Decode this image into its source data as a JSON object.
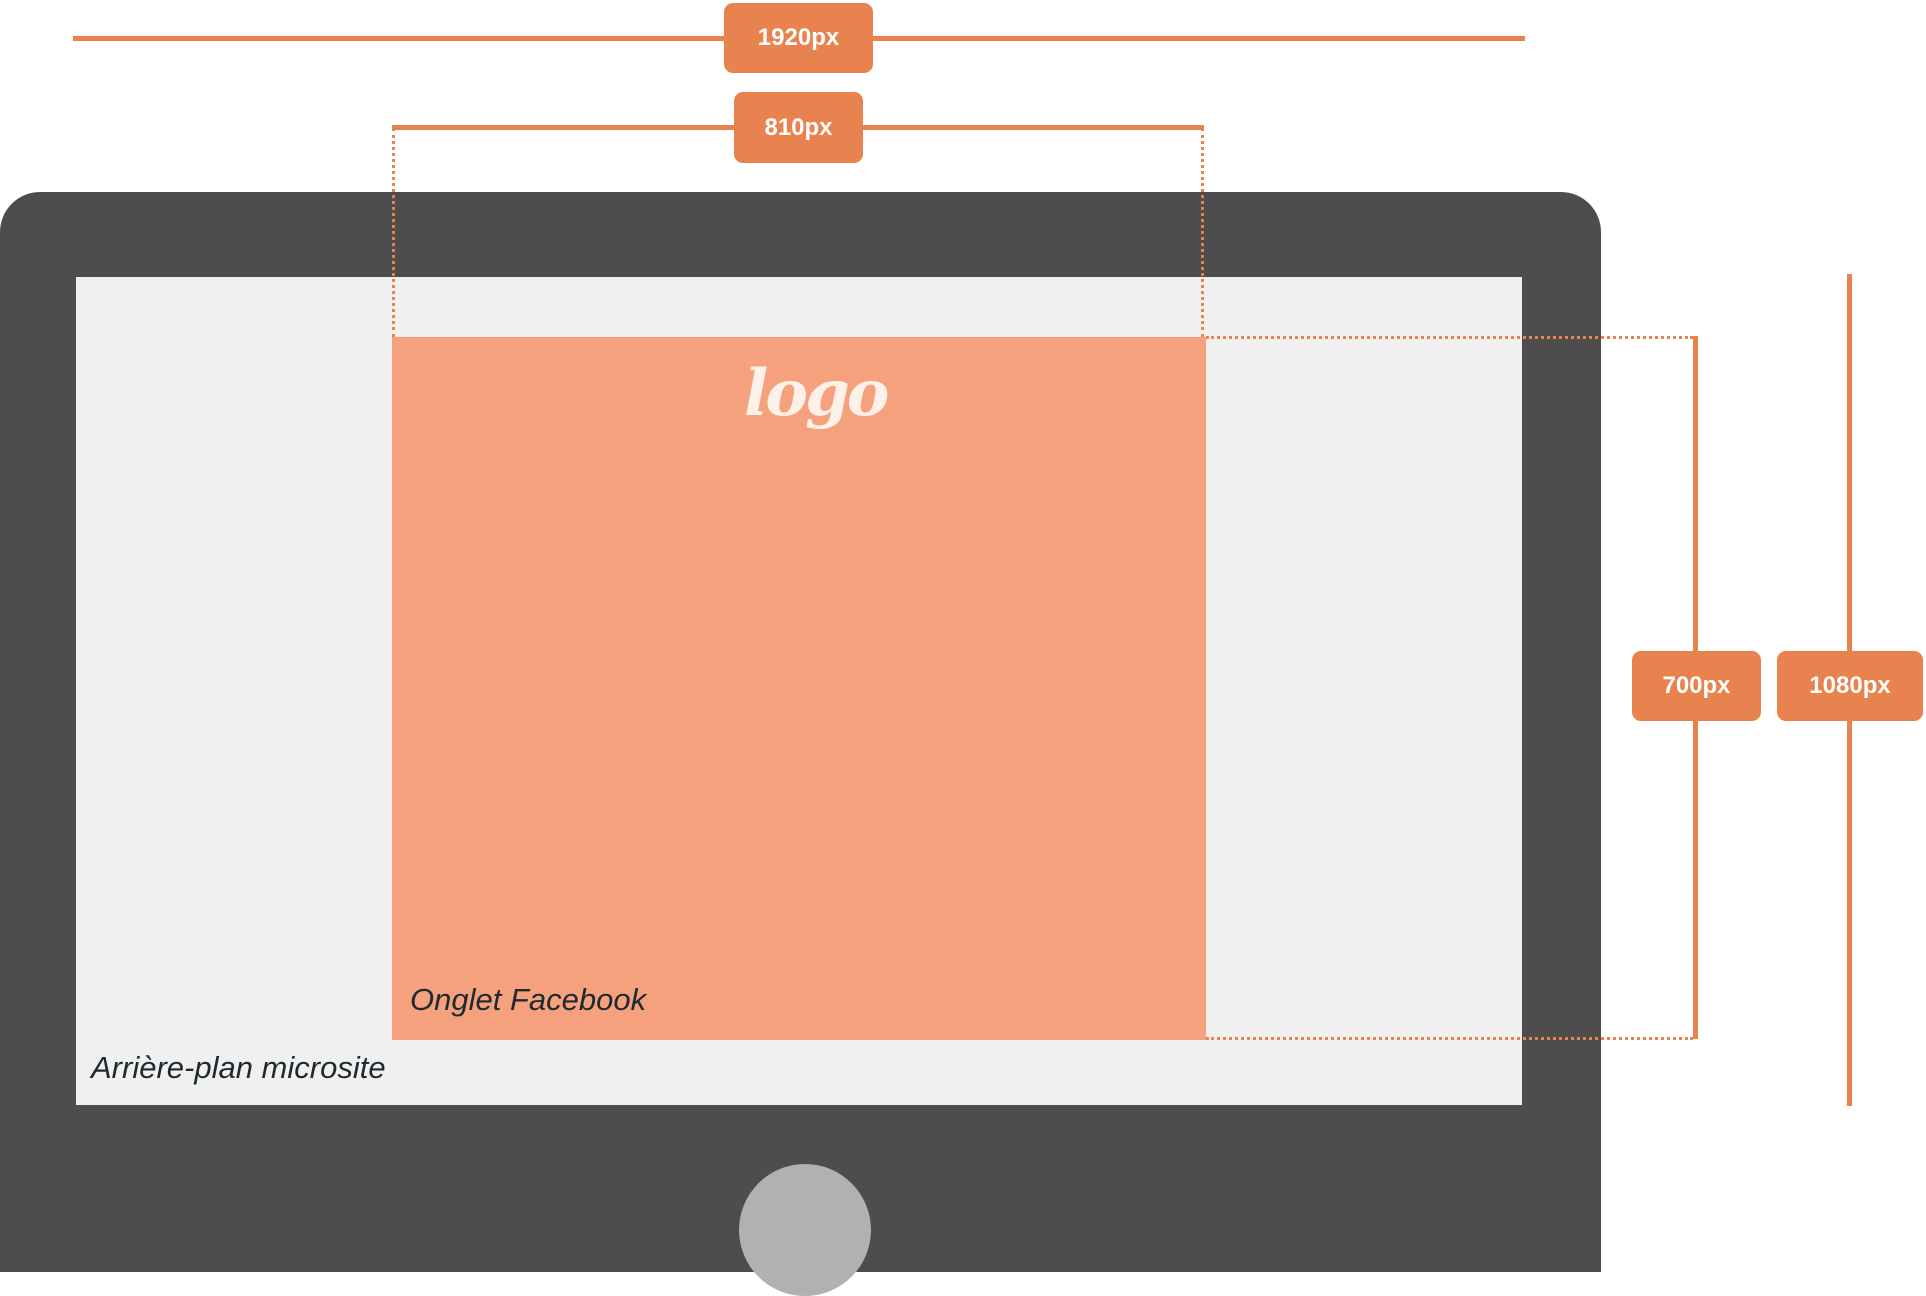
{
  "colors": {
    "accent": "#e8834f",
    "monitor_frame": "#4d4d4d",
    "screen_background": "#f0f0f0",
    "facebook_tab": "#f5a17d",
    "home_button": "#b1b1b1"
  },
  "dimensions": {
    "total_width_label": "1920px",
    "tab_width_label": "810px",
    "tab_height_label": "700px",
    "total_height_label": "1080px"
  },
  "logo": {
    "text": "logo"
  },
  "captions": {
    "facebook_tab": "Onglet Facebook",
    "microsite_background": "Arrière-plan microsite"
  }
}
